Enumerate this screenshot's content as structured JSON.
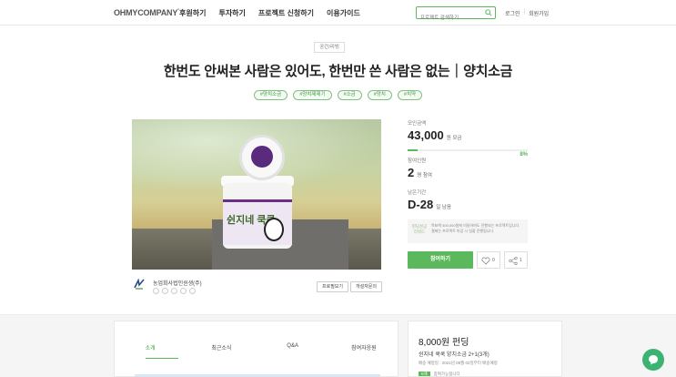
{
  "header": {
    "logo": "OHMYCOMPANY",
    "nav": [
      "후원하기",
      "투자하기",
      "프로젝트 신청하기",
      "이용가이드"
    ],
    "search_placeholder": "프로젝트 검색하기",
    "login": "로그인",
    "signup": "회원가입"
  },
  "project": {
    "category": "공간/리빙",
    "title": "한번도 안써본 사람은 있어도, 한번만 쓴 사람은 없는｜양치소금",
    "tags": [
      "#양치소금",
      "#양치제제기",
      "#소금",
      "#양치",
      "#치약"
    ]
  },
  "hero": {
    "label_text": "쉰지네 쿡쿡"
  },
  "side": {
    "amount_label": "모인금액",
    "amount": "43,000",
    "amount_unit": "원 모금",
    "percent": "8%",
    "progress": 0.08,
    "backers_label": "참여인원",
    "backers": "2",
    "backers_unit": "명 참여",
    "days_label": "남은기간",
    "days": "D-28",
    "days_unit": "일 남음",
    "notice_badge": "펀딩성공리워드",
    "notice_text": "목표액 500,000원에 미달하여도 진행되는 프로젝트입니다. 결제는 프로젝트 마감 시 일괄 진행됩니다.",
    "cta": "참여하기",
    "like_count": "0",
    "share_count": "1"
  },
  "maker": {
    "name": "농업회사법인쉰생(주)",
    "profile_btn": "프로필보기",
    "inquiry_btn": "개설자문의"
  },
  "tabs": [
    "소개",
    "최근소식",
    "Q&A",
    "참여자응원"
  ],
  "tabs_active": "소개",
  "reward": {
    "amount": "8,000원 펀딩",
    "name": "쉰지네 쿡쿡 양치소금 2+1(3개)",
    "ship": "배송 예정일 : 2021년 08월 02일부터 배송예정",
    "left_badge": "0개",
    "left_text": "참여가능합니다"
  },
  "colors": {
    "accent": "#5cb85c"
  }
}
